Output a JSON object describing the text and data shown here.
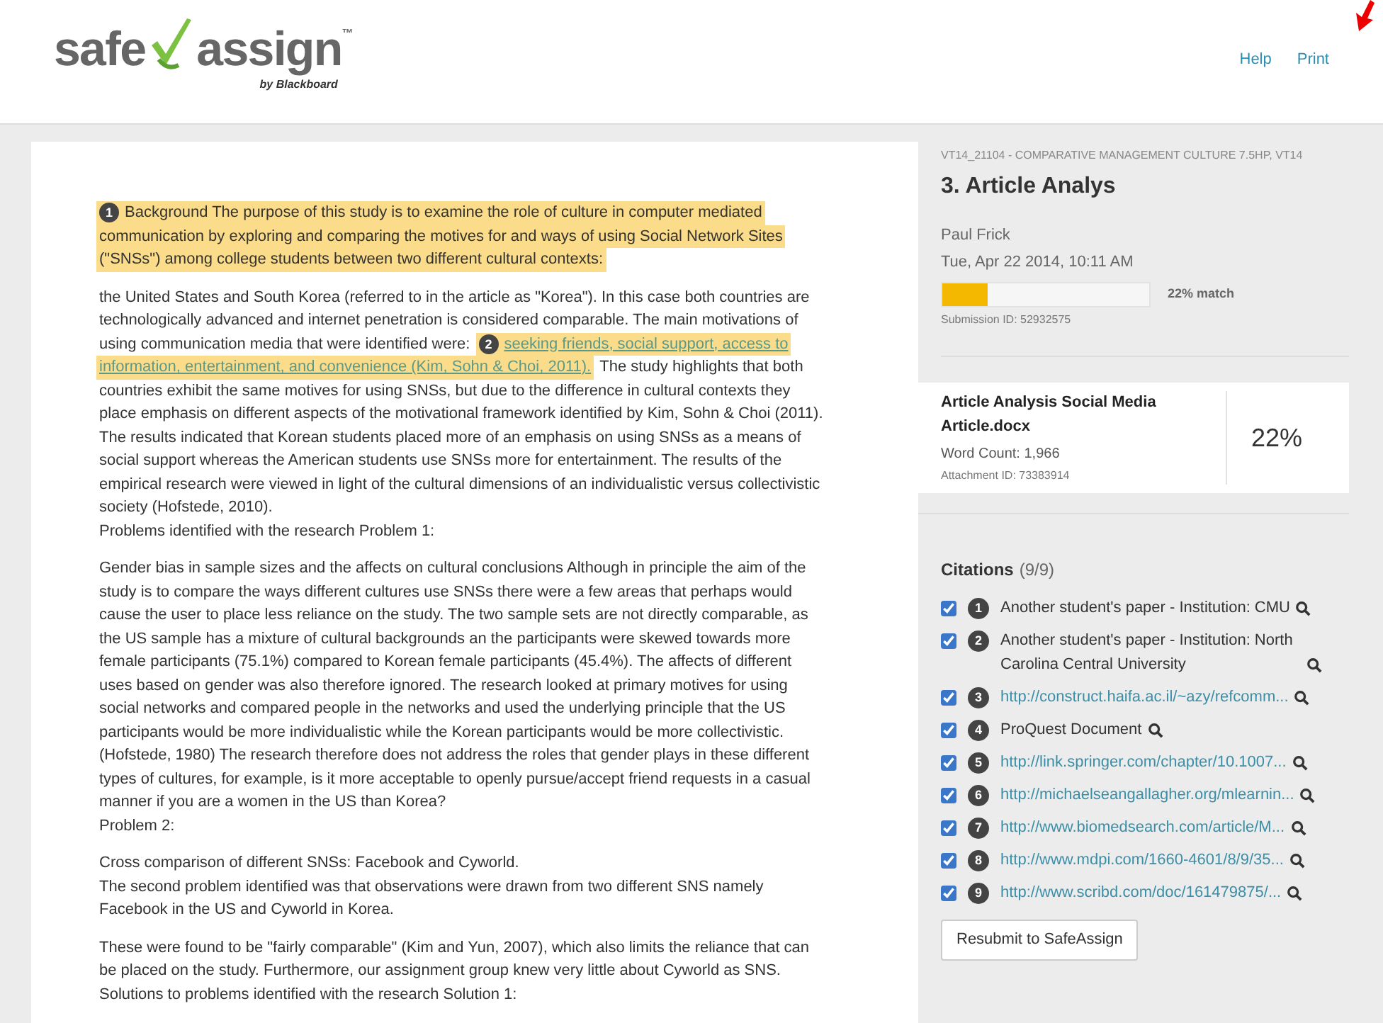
{
  "header": {
    "logo": {
      "left": "safe",
      "right": "assign",
      "tm": "™",
      "byline": "by Blackboard"
    },
    "links": [
      "Help",
      "Print"
    ]
  },
  "document": {
    "sections": [
      {
        "lines": [
          [
            {
              "kind": "match",
              "number": "1",
              "text": "Background The purpose of this study is to examine the role of culture in computer mediated"
            }
          ],
          [
            {
              "kind": "match",
              "text": "communication by exploring and comparing the motives for and ways of using Social Network Sites"
            }
          ],
          [
            {
              "kind": "match",
              "text": "(\"SNSs\") among college students between two different cultural contexts:"
            }
          ]
        ]
      },
      {
        "lines": [
          [
            {
              "kind": "text",
              "text": "the United States and South Korea (referred to in the article as \"Korea\"). In this case both countries are"
            }
          ],
          [
            {
              "kind": "text",
              "text": "technologically advanced and internet penetration is considered comparable. The main motivations of"
            }
          ],
          [
            {
              "kind": "text",
              "text": "using communication media that were identified were:"
            },
            {
              "kind": "match_link",
              "number": "2",
              "text": "seeking friends, social support, access to"
            }
          ],
          [
            {
              "kind": "match_link",
              "text": "information, entertainment, and convenience (Kim, Sohn & Choi, 2011)."
            },
            {
              "kind": "text",
              "text": "The study highlights that both"
            }
          ],
          [
            {
              "kind": "text",
              "text": "countries exhibit the same motives for using SNSs, but due to the difference in cultural contexts they"
            }
          ],
          [
            {
              "kind": "text",
              "text": "place emphasis on different aspects of the motivational framework identified by Kim, Sohn & Choi (2011)."
            }
          ],
          [
            {
              "kind": "text",
              "text": "The results indicated that Korean students placed more of an emphasis on using SNSs as a means of"
            }
          ],
          [
            {
              "kind": "text",
              "text": "social support whereas the American students use SNSs more for entertainment. The results of the"
            }
          ],
          [
            {
              "kind": "text",
              "text": "empirical research were viewed in light of the cultural dimensions of an individualistic versus collectivistic"
            }
          ],
          [
            {
              "kind": "text",
              "text": "society (Hofstede, 2010)."
            }
          ],
          [
            {
              "kind": "text",
              "text": "Problems identified with the research Problem 1:"
            }
          ]
        ]
      },
      {
        "lines": [
          [
            {
              "kind": "text",
              "text": "Gender bias in sample sizes and the affects on cultural conclusions Although in principle the aim of the"
            }
          ],
          [
            {
              "kind": "text",
              "text": "study is to compare the ways different cultures use SNSs there were a few areas that perhaps would"
            }
          ],
          [
            {
              "kind": "text",
              "text": "cause the user to place less reliance on the study. The two sample sets are not directly comparable, as"
            }
          ],
          [
            {
              "kind": "text",
              "text": "the US sample has a mixture of cultural backgrounds an the participants were skewed towards more"
            }
          ],
          [
            {
              "kind": "text",
              "text": "female participants (75.1%) compared to Korean female participants (45.4%). The affects of different"
            }
          ],
          [
            {
              "kind": "text",
              "text": "uses based on gender was also therefore ignored. The research looked at primary motives for using"
            }
          ],
          [
            {
              "kind": "text",
              "text": "social networks and compared people in the networks and used the underlying principle that the US"
            }
          ],
          [
            {
              "kind": "text",
              "text": "participants would be more individualistic while the Korean participants would be more collectivistic."
            }
          ],
          [
            {
              "kind": "text",
              "text": "(Hofstede, 1980) The research therefore does not address the roles that gender plays in these different"
            }
          ],
          [
            {
              "kind": "text",
              "text": "types of cultures, for example, is it more acceptable to openly pursue/accept friend requests in a casual"
            }
          ],
          [
            {
              "kind": "text",
              "text": "manner if you are a women in the US than Korea?"
            }
          ],
          [
            {
              "kind": "text",
              "text": "Problem 2:"
            }
          ]
        ]
      },
      {
        "lines": [
          [
            {
              "kind": "text",
              "text": "Cross comparison of different SNSs: Facebook and Cyworld."
            }
          ],
          [
            {
              "kind": "text",
              "text": "The second problem identified was that observations were drawn from two different SNS namely"
            }
          ],
          [
            {
              "kind": "text",
              "text": "Facebook in the US and Cyworld in Korea."
            }
          ]
        ]
      },
      {
        "lines": [
          [
            {
              "kind": "text",
              "text": "These were found to be \"fairly comparable\" (Kim and Yun, 2007), which also limits the reliance that can"
            }
          ],
          [
            {
              "kind": "text",
              "text": "be placed on the study. Furthermore, our assignment group knew very little about Cyworld as SNS."
            }
          ],
          [
            {
              "kind": "text",
              "text": "Solutions to problems identified with the research Solution 1:"
            }
          ]
        ]
      }
    ]
  },
  "sidebar": {
    "course": "VT14_21104 - COMPARATIVE MANAGEMENT CULTURE 7.5HP, VT14",
    "title": "3. Article Analys",
    "author": "Paul Frick",
    "date": "Tue, Apr 22 2014, 10:11 AM",
    "match": {
      "level": 0.22,
      "label": "22% match"
    },
    "submission_id": "Submission ID: 52932575",
    "attachment": {
      "name": "Article Analysis Social Media Article.docx",
      "word_count": "Word Count: 1,966",
      "attachment_id": "Attachment ID: 73383914",
      "percent": "22%"
    },
    "citations": {
      "title": "Citations",
      "count": "(9/9)",
      "items": [
        {
          "number": "1",
          "kind": "source",
          "text": "Another student's paper - Institution: CMU",
          "checked": true
        },
        {
          "number": "2",
          "kind": "source",
          "text": "Another student's paper - Institution: North Carolina Central University",
          "checked": true
        },
        {
          "number": "3",
          "kind": "link",
          "text": "http://construct.haifa.ac.il/~azy/refcomm...",
          "checked": true
        },
        {
          "number": "4",
          "kind": "source",
          "text": "ProQuest Document",
          "checked": true
        },
        {
          "number": "5",
          "kind": "link",
          "text": "http://link.springer.com/chapter/10.1007...",
          "checked": true
        },
        {
          "number": "6",
          "kind": "link",
          "text": "http://michaelseangallagher.org/mlearnin...",
          "checked": true
        },
        {
          "number": "7",
          "kind": "link",
          "text": "http://www.biomedsearch.com/article/M...",
          "checked": true
        },
        {
          "number": "8",
          "kind": "link",
          "text": "http://www.mdpi.com/1660-4601/8/9/35...",
          "checked": true
        },
        {
          "number": "9",
          "kind": "link",
          "text": "http://www.scribd.com/doc/161479875/...",
          "checked": true
        }
      ]
    },
    "resubmit": "Resubmit to SafeAssign"
  }
}
